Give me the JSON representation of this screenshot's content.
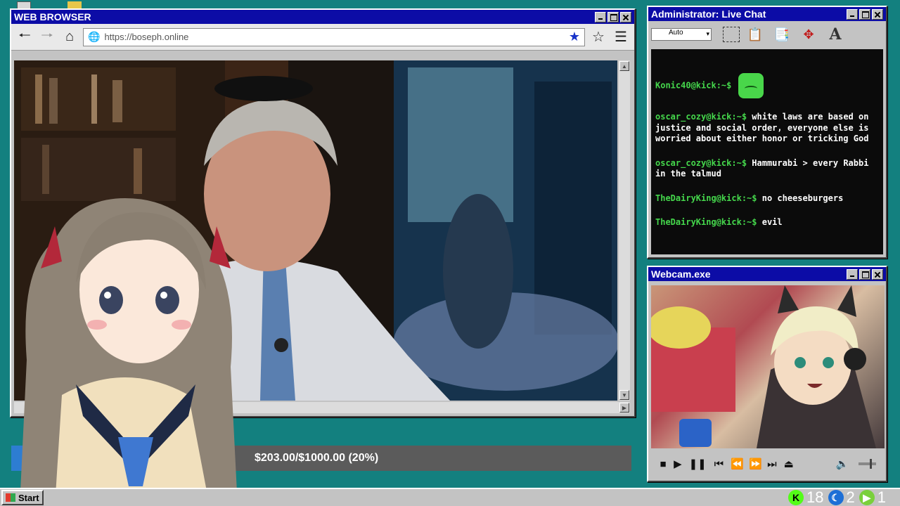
{
  "browser": {
    "title": "WEB BROWSER",
    "url": "https://boseph.online",
    "icons": [
      "back-arrow-icon",
      "forward-arrow-icon",
      "home-icon",
      "globe-icon",
      "bookmark-star-icon",
      "star-outline-icon",
      "menu-icon"
    ]
  },
  "chat": {
    "title": "Administrator: Live Chat",
    "toolbar_select": "Auto",
    "messages": [
      {
        "user": "Konic40@kick:~$",
        "text": "",
        "emote": "sick-face-emote"
      },
      {
        "user": "oscar_cozy@kick:~$",
        "text": "white laws are based on justice and social order, everyone else is worried about either honor or tricking God"
      },
      {
        "user": "oscar_cozy@kick:~$",
        "text": "Hammurabi > every Rabbi in the talmud"
      },
      {
        "user": "TheDairyKing@kick:~$",
        "text": "no cheeseburgers"
      },
      {
        "user": "TheDairyKing@kick:~$",
        "text": "evil"
      }
    ]
  },
  "webcam": {
    "title": "Webcam.exe"
  },
  "donation": {
    "text": "$203.00/$1000.00 (20%)",
    "progress": 0.203
  },
  "taskbar": {
    "start_label": "Start",
    "stat1": "18",
    "stat2": "2",
    "stat3": "1",
    "kick_letter": "K"
  },
  "colors": {
    "desktop": "#13807f",
    "titlebar": "#0c0ca6",
    "chat_username": "#45d84c",
    "kick_green": "#53fc18"
  }
}
